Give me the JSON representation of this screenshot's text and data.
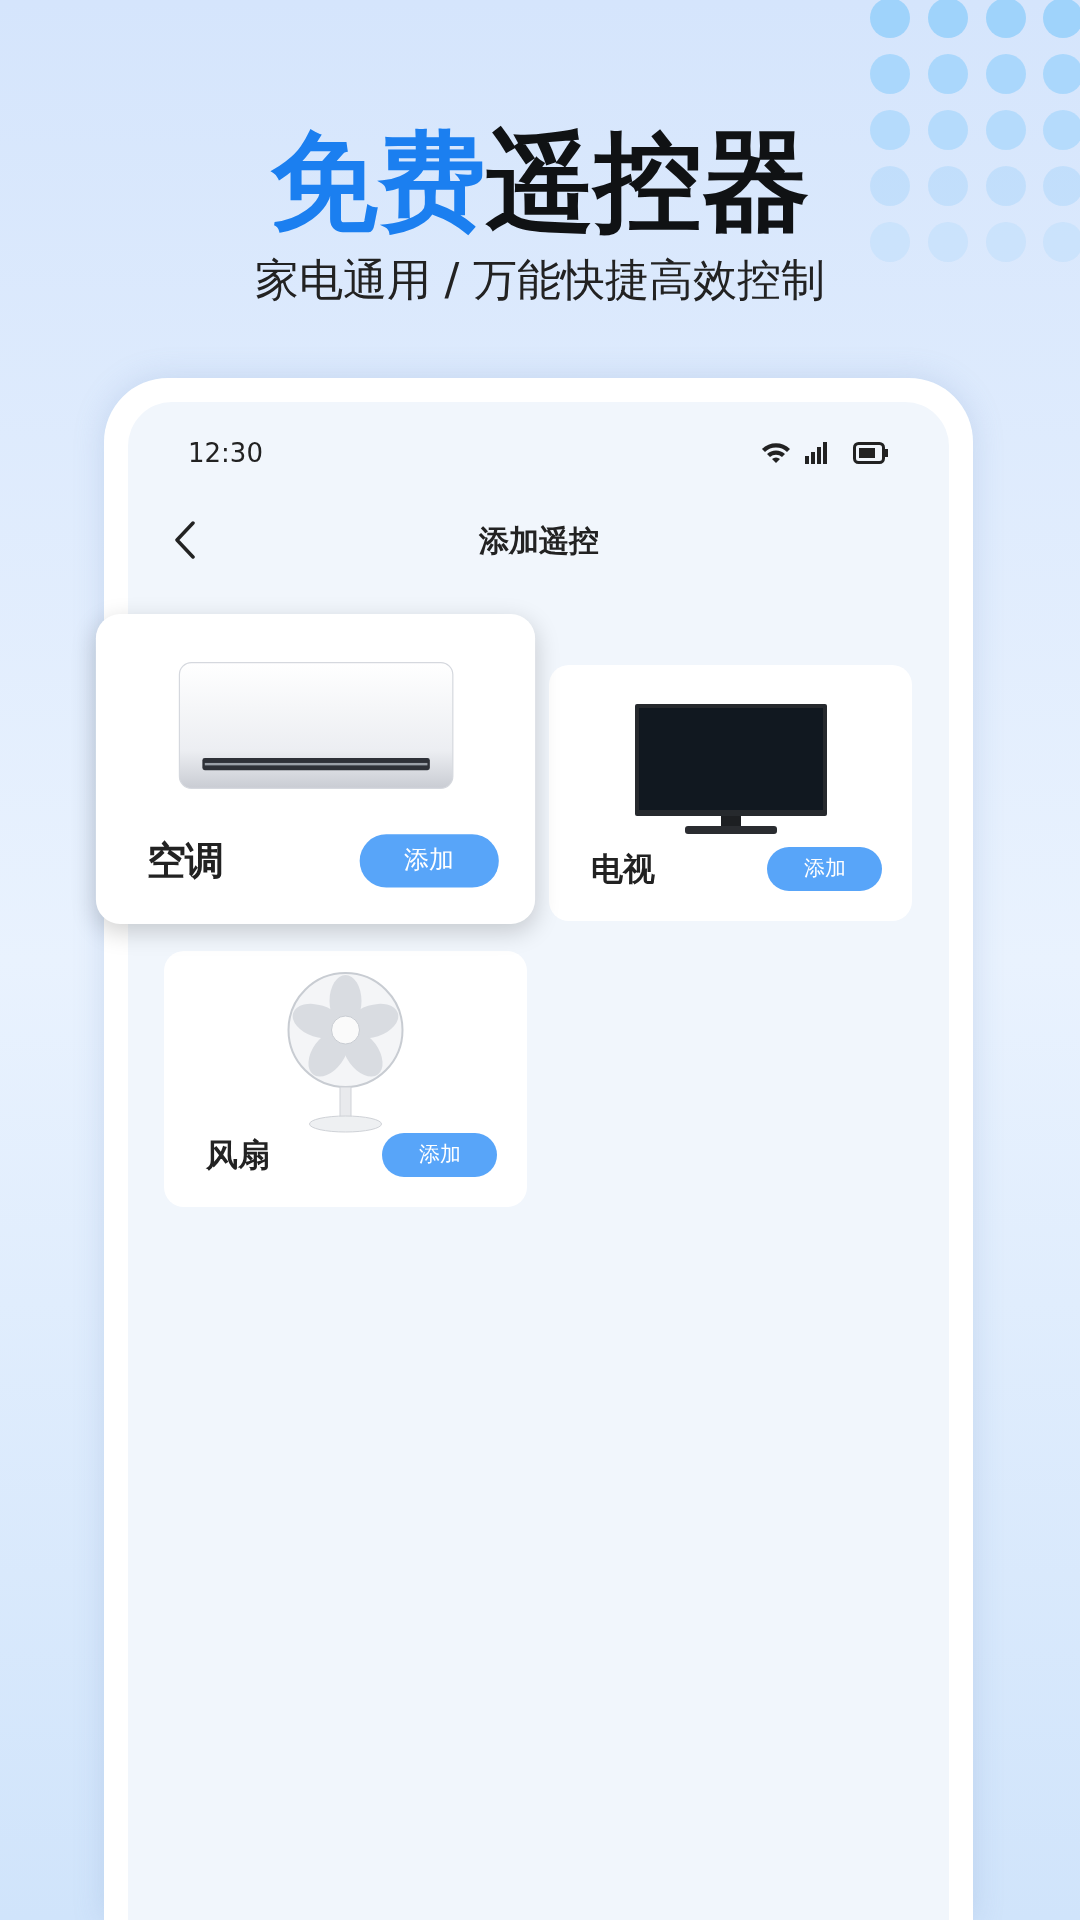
{
  "headline": {
    "highlight": "免费",
    "rest": "遥控器"
  },
  "subtitle": "家电通用 / 万能快捷高效控制",
  "phone": {
    "status_bar": {
      "time": "12:30"
    },
    "nav": {
      "title": "添加遥控"
    },
    "devices": [
      {
        "kind": "ac",
        "name": "空调",
        "button": "添加",
        "selected": true
      },
      {
        "kind": "tv",
        "name": "电视",
        "button": "添加",
        "selected": false
      },
      {
        "kind": "fan",
        "name": "风扇",
        "button": "添加",
        "selected": false
      }
    ]
  }
}
